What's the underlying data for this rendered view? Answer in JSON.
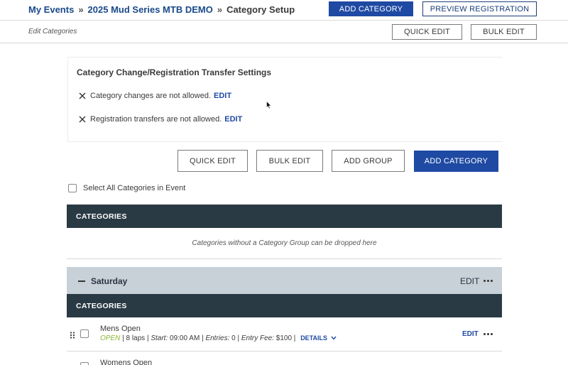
{
  "breadcrumb": {
    "my_events": "My Events",
    "sep1": "»",
    "event": "2025 Mud Series MTB DEMO",
    "sep2": "»",
    "current": "Category Setup"
  },
  "header": {
    "add_category": "ADD CATEGORY",
    "preview_registration": "PREVIEW REGISTRATION"
  },
  "subheader": {
    "title": "Edit Categories",
    "quick_edit": "QUICK EDIT",
    "bulk_edit": "BULK EDIT"
  },
  "settings": {
    "title": "Category Change/Registration Transfer Settings",
    "items": [
      {
        "text": "Category changes are not allowed.",
        "action": "EDIT"
      },
      {
        "text": "Registration transfers are not allowed.",
        "action": "EDIT"
      }
    ]
  },
  "actions": {
    "quick_edit": "QUICK EDIT",
    "bulk_edit": "BULK EDIT",
    "add_group": "ADD GROUP",
    "add_category": "ADD CATEGORY"
  },
  "select_all": {
    "label": "Select All Categories in Event",
    "checked": false
  },
  "ungrouped": {
    "header": "CATEGORIES",
    "dropzone_text": "Categories without a Category Group can be dropped here"
  },
  "group": {
    "name": "Saturday",
    "edit": "EDIT",
    "header": "CATEGORIES",
    "categories": [
      {
        "name": "Mens Open",
        "status": "OPEN",
        "laps": "8 laps",
        "start_label": "Start:",
        "start": "09:00 AM",
        "entries_label": "Entries:",
        "entries": "0",
        "fee_label": "Entry Fee:",
        "fee": "$100",
        "details": "DETAILS",
        "edit": "EDIT"
      },
      {
        "name": "Womens Open"
      }
    ]
  },
  "colors": {
    "primary": "#1f4aa3",
    "dark_header": "#2a3a44",
    "group_bar": "#c8d0d8",
    "status_open": "#8ab832"
  }
}
